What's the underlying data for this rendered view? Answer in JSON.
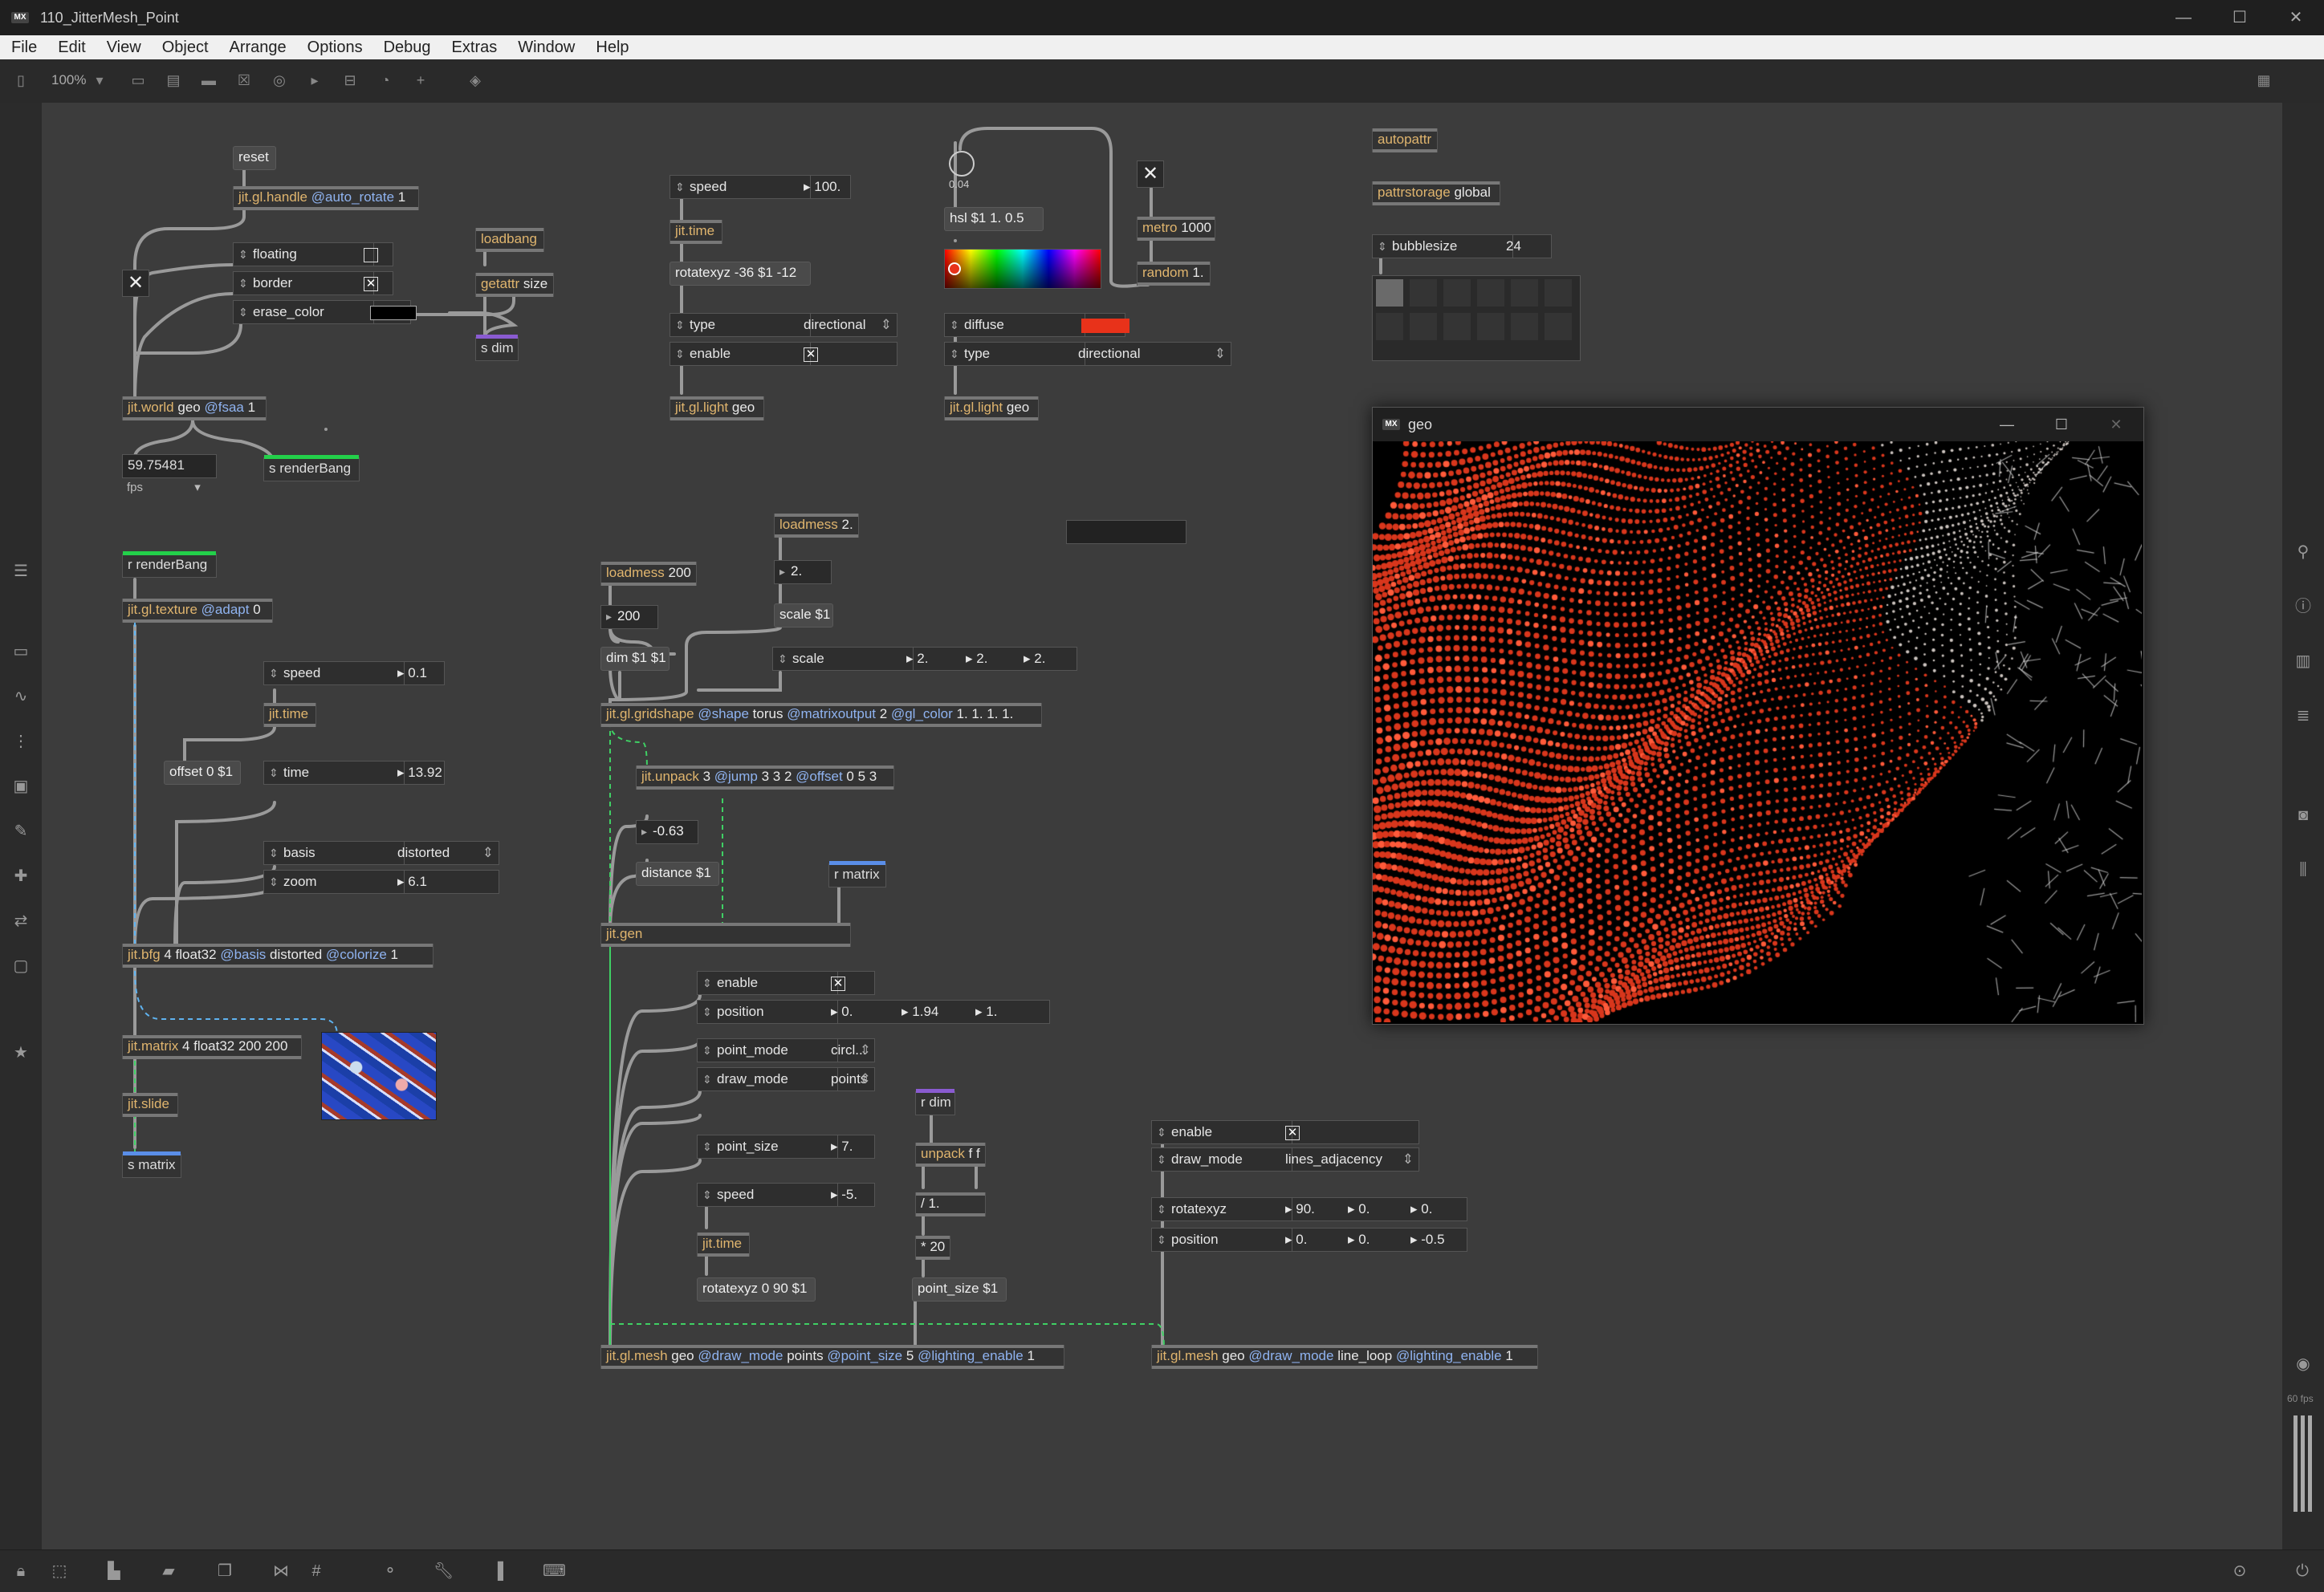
{
  "window": {
    "title": "110_JitterMesh_Point",
    "minimize": "—",
    "maximize": "☐",
    "close": "✕"
  },
  "menu": [
    "File",
    "Edit",
    "View",
    "Object",
    "Arrange",
    "Options",
    "Debug",
    "Extras",
    "Window",
    "Help"
  ],
  "toolbar": {
    "zoom": "100%"
  },
  "footer": {
    "fps_label": "60 fps"
  },
  "patch": {
    "reset": "reset",
    "handle": {
      "name": "jit.gl.handle",
      "attr": "@auto_rotate",
      "val": "1"
    },
    "floating": "floating",
    "border": "border",
    "erase_color": "erase_color",
    "loadbang": "loadbang",
    "getattr": "getattr size",
    "s_dim": "s dim",
    "world": {
      "name": "jit.world",
      "arg": "geo",
      "attr": "@fsaa",
      "val": "1"
    },
    "fps_value": "59.75481",
    "fps_unit": "fps",
    "s_renderbang": "s renderBang",
    "r_renderbang": "r renderBang",
    "texture": {
      "name": "jit.gl.texture",
      "attr": "@adapt",
      "val": "0"
    },
    "speed1": {
      "label": "speed",
      "value": "0.1"
    },
    "jit_time": "jit.time",
    "offset": "offset 0 $1",
    "time": {
      "label": "time",
      "value": "13.92"
    },
    "basis": {
      "label": "basis",
      "value": "distorted"
    },
    "zoom": {
      "label": "zoom",
      "value": "6.1"
    },
    "bfg": {
      "name": "jit.bfg",
      "args": "4 float32",
      "attr1": "@basis",
      "arg1": "distorted",
      "attr2": "@colorize",
      "arg2": "1"
    },
    "matrix": "jit.matrix 4 float32 200 200",
    "slide": "jit.slide",
    "s_matrix": "s matrix",
    "speed2": {
      "label": "speed",
      "value": "100."
    },
    "rotatexyz1": "rotatexyz -36 $1 -12",
    "type1": {
      "label": "type",
      "value": "directional"
    },
    "enable1": "enable",
    "light1": "jit.gl.light geo",
    "dial_value": "0.04",
    "hsl": "hsl $1 1. 0.5",
    "metro": "metro 1000",
    "random": "random 1.",
    "diffuse": "diffuse",
    "type2": {
      "label": "type",
      "value": "directional"
    },
    "light2": "jit.gl.light geo",
    "autopattr": "autopattr",
    "pattrstorage": {
      "name": "pattrstorage",
      "arg": "global"
    },
    "bubblesize": {
      "label": "bubblesize",
      "value": "24"
    },
    "loadmess200": "loadmess 200",
    "num200": "200",
    "dim": "dim $1 $1",
    "loadmess2": "loadmess 2.",
    "num2": "2.",
    "scale_msg": "scale $1",
    "scale": {
      "label": "scale",
      "v1": "2.",
      "v2": "2.",
      "v3": "2."
    },
    "gridshape": {
      "name": "jit.gl.gridshape",
      "a1": "@shape",
      "v1": "torus",
      "a2": "@matrixoutput",
      "v2": "2",
      "a3": "@gl_color",
      "v3": "1. 1. 1. 1."
    },
    "unpack3": {
      "name": "jit.unpack",
      "args": "3",
      "a1": "@jump",
      "v1": "3 3 2",
      "a2": "@offset",
      "v2": "0 5 3"
    },
    "num_neg": "-0.63",
    "distance": "distance $1",
    "r_matrix": "r matrix",
    "gen": "jit.gen",
    "enable2": "enable",
    "position1": {
      "label": "position",
      "v1": "0.",
      "v2": "1.94",
      "v3": "1."
    },
    "point_mode": {
      "label": "point_mode",
      "value": "circl..."
    },
    "draw_mode1": {
      "label": "draw_mode",
      "value": "points"
    },
    "point_size": {
      "label": "point_size",
      "value": "7."
    },
    "speed3": {
      "label": "speed",
      "value": "-5."
    },
    "jit_time2": "jit.time",
    "rotatexyz2": "rotatexyz 0 90 $1",
    "r_dim": "r dim",
    "unpack_ff": "unpack f f",
    "div1": "/ 1.",
    "mul20": "* 20",
    "point_size_msg": "point_size $1",
    "mesh1": {
      "name": "jit.gl.mesh",
      "arg": "geo",
      "a1": "@draw_mode",
      "v1": "points",
      "a2": "@point_size",
      "v2": "5",
      "a3": "@lighting_enable",
      "v3": "1"
    },
    "enable3": "enable",
    "draw_mode2": {
      "label": "draw_mode",
      "value": "lines_adjacency"
    },
    "rotatexyz3": {
      "label": "rotatexyz",
      "v1": "90.",
      "v2": "0.",
      "v3": "0."
    },
    "position2": {
      "label": "position",
      "v1": "0.",
      "v2": "0.",
      "v3": "-0.5"
    },
    "mesh2": {
      "name": "jit.gl.mesh",
      "arg": "geo",
      "a1": "@draw_mode",
      "v1": "line_loop",
      "a2": "@lighting_enable",
      "v2": "1"
    }
  },
  "geo_window": {
    "title": "geo"
  },
  "colors": {
    "canvas": "#3c3c3c",
    "send": "#23d04a",
    "receive": "#5a8ee8",
    "diffuse": "#e8321a"
  }
}
